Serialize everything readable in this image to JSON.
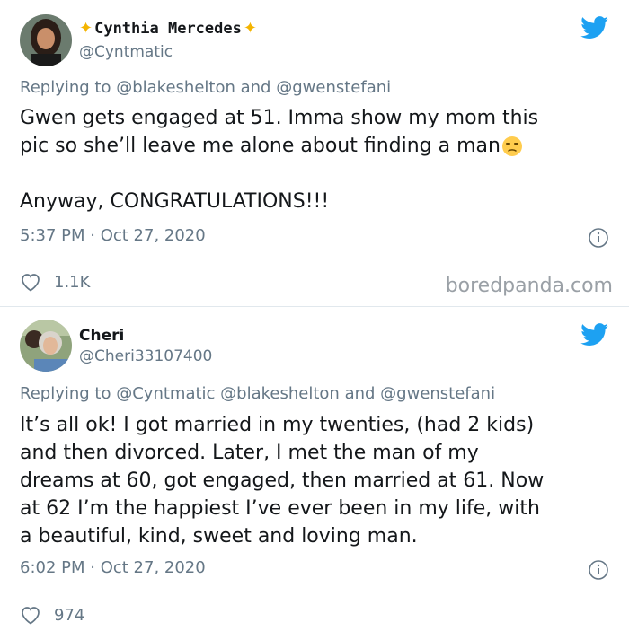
{
  "tweets": [
    {
      "display_name": "Cynthia Mercedes",
      "name_decoration": "sparkle-emoji",
      "handle": "@Cyntmatic",
      "replying_prefix": "Replying to",
      "replying_mentions": [
        "@blakeshelton",
        "and",
        "@gwenstefani"
      ],
      "body_lines": [
        "Gwen gets engaged at 51. Imma show my mom this",
        "pic so she’ll leave me alone about finding a man"
      ],
      "body_emoji": "unamused-face-emoji",
      "body_line_3": "Anyway, CONGRATULATIONS!!!",
      "time": "5:37 PM · Oct 27, 2020",
      "likes": "1.1K",
      "watermark": "boredpanda.com"
    },
    {
      "display_name": "Cheri",
      "handle": "@Cheri33107400",
      "replying_prefix": "Replying to",
      "replying_mentions": [
        "@Cyntmatic",
        "@blakeshelton",
        "and",
        "@gwenstefani"
      ],
      "body_lines": [
        "It’s all ok! I got married in my twenties, (had 2 kids)",
        "and then divorced. Later, I met the man of my",
        "dreams at 60, got engaged, then married at 61. Now",
        "at 62 I’m the happiest I’ve ever been in my life, with",
        "a beautiful, kind, sweet and loving man."
      ],
      "time": "6:02 PM · Oct 27, 2020",
      "likes": "974"
    }
  ],
  "icons": {
    "brand": "twitter-bird-icon",
    "info": "info-icon",
    "like": "heart-icon"
  },
  "colors": {
    "twitter_blue": "#1da1f2",
    "secondary_text": "#657786",
    "primary_text": "#14171a",
    "divider": "#e1e8ed",
    "sparkle": "#f4b400"
  }
}
